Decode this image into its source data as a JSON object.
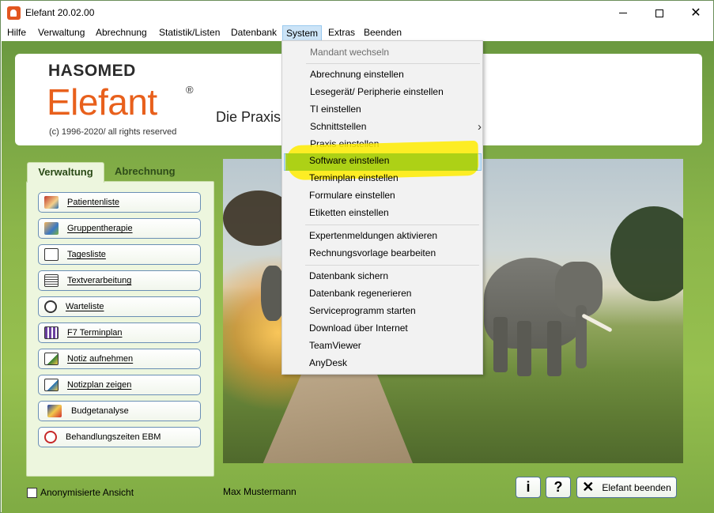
{
  "window": {
    "title": "Elefant 20.02.00",
    "minimize_label": "—",
    "maximize_label": "□",
    "close_label": "✕"
  },
  "menubar": {
    "items": [
      "Hilfe",
      "Verwaltung",
      "Abrechnung",
      "Statistik/Listen",
      "Datenbank",
      "System",
      "Extras",
      "Beenden"
    ],
    "active": "System"
  },
  "header": {
    "brand": "HASOMED",
    "product": "Elefant",
    "registered": "®",
    "copyright": "(c) 1996-2020/ all rights reserved",
    "tagline": "Die Praxis"
  },
  "tabs": {
    "active": "Verwaltung",
    "inactive": "Abrechnung"
  },
  "nav": {
    "items": [
      {
        "label": "Patientenliste",
        "icon": "patient-icon"
      },
      {
        "label": "Gruppentherapie",
        "icon": "group-icon"
      },
      {
        "label": "Tagesliste",
        "icon": "calendar-day-icon"
      },
      {
        "label": "Textverarbeitung",
        "icon": "document-icon"
      },
      {
        "label": "Warteliste",
        "icon": "clock-icon"
      },
      {
        "label": "F7 Terminplan",
        "icon": "schedule-grid-icon"
      },
      {
        "label": "Notiz aufnehmen",
        "icon": "note-add-icon"
      },
      {
        "label": "Notizplan zeigen",
        "icon": "note-plan-icon"
      },
      {
        "label": "Budgetanalyse",
        "icon": "budget-icon"
      },
      {
        "label": "Behandlungszeiten EBM",
        "icon": "stopwatch-icon"
      }
    ]
  },
  "dropdown": {
    "items": [
      {
        "label": "Mandant wechseln",
        "disabled": true
      },
      {
        "label": "Abrechnung einstellen"
      },
      {
        "label": "Lesegerät/ Peripherie einstellen"
      },
      {
        "label": "TI einstellen"
      },
      {
        "label": "Schnittstellen",
        "submenu": true
      },
      {
        "label": "Praxis einstellen"
      },
      {
        "label": "Software einstellen",
        "highlighted": true
      },
      {
        "label": "Terminplan einstellen"
      },
      {
        "label": "Formulare einstellen"
      },
      {
        "label": "Etiketten einstellen"
      },
      {
        "label": "Expertenmeldungen aktivieren"
      },
      {
        "label": "Rechnungsvorlage bearbeiten"
      },
      {
        "label": "Datenbank sichern"
      },
      {
        "label": "Datenbank regenerieren"
      },
      {
        "label": "Serviceprogramm starten"
      },
      {
        "label": "Download über Internet"
      },
      {
        "label": "TeamViewer"
      },
      {
        "label": "AnyDesk"
      }
    ],
    "submenu_arrow": "›"
  },
  "footer": {
    "anonym_label": "Anonymisierte Ansicht",
    "anonym_checked": false,
    "user": "Max Mustermann",
    "info_label": "i",
    "help_label": "?",
    "quit_icon": "✕",
    "quit_label": "Elefant beenden"
  },
  "colors": {
    "brand_orange": "#e8601c",
    "panel_green": "#edf6de",
    "main_green": "#8cb64a",
    "highlight_yellow": "#ffec00",
    "highlight_green": "#a0cd14"
  }
}
